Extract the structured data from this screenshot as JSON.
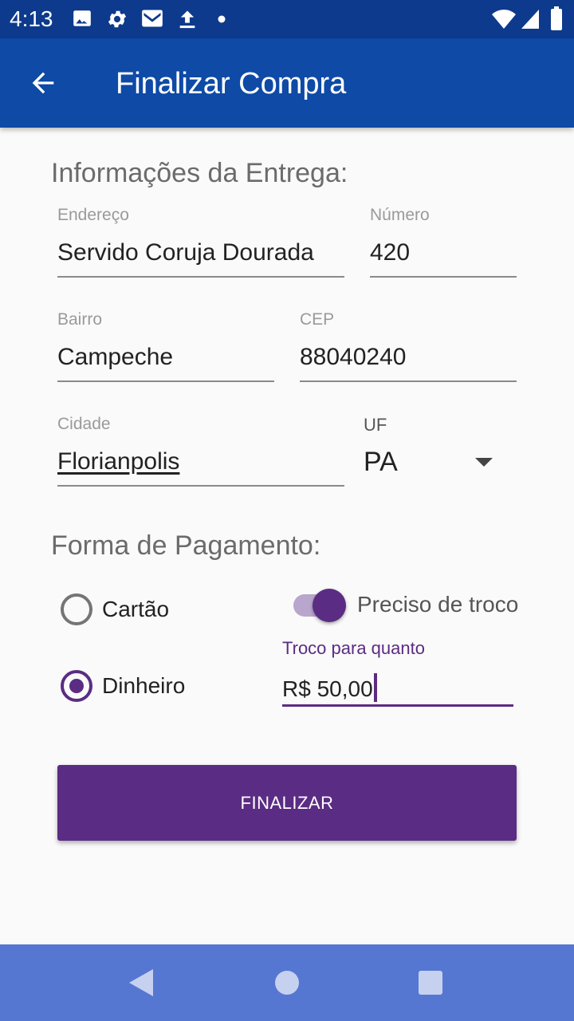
{
  "status_bar": {
    "time": "4:13",
    "left_icons": [
      "image-icon",
      "gear-icon",
      "gmail-icon",
      "upload-icon",
      "dot-icon"
    ],
    "right_icons": [
      "wifi-icon",
      "signal-icon",
      "battery-icon"
    ]
  },
  "app_bar": {
    "title": "Finalizar Compra",
    "back_icon": "arrow-back-icon"
  },
  "entrega": {
    "title": "Informações da Entrega:",
    "endereco": {
      "label": "Endereço",
      "value": "Servido Coruja Dourada"
    },
    "numero": {
      "label": "Número",
      "value": "420"
    },
    "bairro": {
      "label": "Bairro",
      "value": "Campeche"
    },
    "cep": {
      "label": "CEP",
      "value": "88040240"
    },
    "cidade": {
      "label": "Cidade",
      "value": "Florianpolis"
    },
    "uf": {
      "label": "UF",
      "value": "PA"
    }
  },
  "pagamento": {
    "title": "Forma de Pagamento:",
    "cartao_label": "Cartão",
    "cartao_checked": false,
    "dinheiro_label": "Dinheiro",
    "dinheiro_checked": true,
    "troco_switch_label": "Preciso de troco",
    "troco_switch_on": true,
    "troco_label": "Troco para quanto",
    "troco_value": "R$ 50,00"
  },
  "actions": {
    "finalizar_label": "FINALIZAR"
  },
  "colors": {
    "status_bar": "#0d3a8c",
    "app_bar": "#0e4aa6",
    "accent": "#5b2c83",
    "nav_bar": "#5677d1"
  }
}
